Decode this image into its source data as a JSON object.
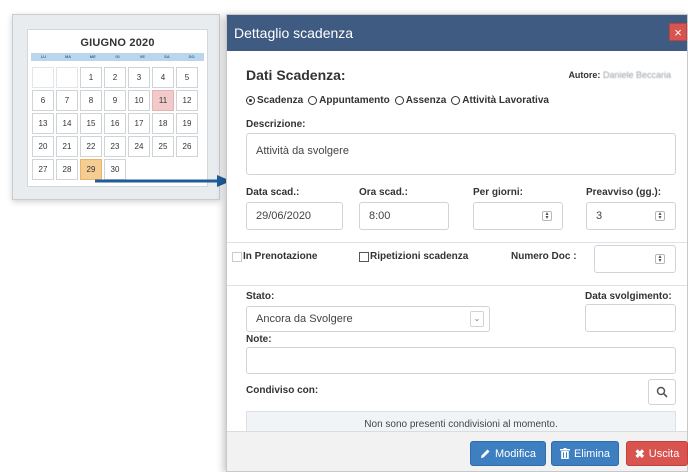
{
  "calendar": {
    "title": "GIUGNO 2020",
    "weekdays": [
      "LU",
      "MA",
      "ME",
      "GI",
      "VE",
      "SA",
      "DO"
    ],
    "rows": [
      [
        "",
        "",
        "1",
        "2",
        "3",
        "4",
        "5"
      ],
      [
        "6",
        "7",
        "8",
        "9",
        "10",
        "11",
        "12"
      ],
      [
        "13",
        "14",
        "15",
        "16",
        "17",
        "18",
        "19"
      ],
      [
        "20",
        "21",
        "22",
        "23",
        "24",
        "25",
        "26"
      ],
      [
        "27",
        "28",
        "29",
        "30",
        "",
        "",
        ""
      ]
    ],
    "highlighted_day": "11",
    "selected_day": "29"
  },
  "dialog": {
    "title": "Dettaglio scadenza",
    "close_icon": "×",
    "section_title": "Dati Scadenza:",
    "author_label": "Autore:",
    "author_value": "Daniele Beccaria",
    "type_options": [
      "Scadenza",
      "Appuntamento",
      "Assenza",
      "Attività Lavorativa"
    ],
    "selected_type": "Scadenza",
    "description_label": "Descrizione:",
    "description_value": "Attività da svolgere",
    "due_date_label": "Data scad.:",
    "due_date_value": "29/06/2020",
    "due_time_label": "Ora scad.:",
    "due_time_value": "8:00",
    "per_days_label": "Per giorni:",
    "per_days_value": "",
    "notice_label": "Preavviso (gg.):",
    "notice_value": "3",
    "booking_label": "In Prenotazione",
    "repeat_label": "Ripetizioni scadenza",
    "doc_number_label": "Numero Doc :",
    "doc_number_value": "",
    "status_label": "Stato:",
    "status_value": "Ancora da Svolgere",
    "completion_date_label": "Data svolgimento:",
    "completion_date_value": "",
    "notes_label": "Note:",
    "notes_value": "",
    "shared_label": "Condiviso con:",
    "shared_empty": "Non sono presenti condivisioni al momento.",
    "buttons": {
      "edit": "Modifica",
      "delete": "Elimina",
      "exit": "Uscita"
    }
  },
  "colors": {
    "header": "#3f5b82",
    "button_blue": "#3e7fc1",
    "button_red": "#d9534f",
    "day_highlight": "#f2caca",
    "day_selected": "#f5cd93"
  }
}
